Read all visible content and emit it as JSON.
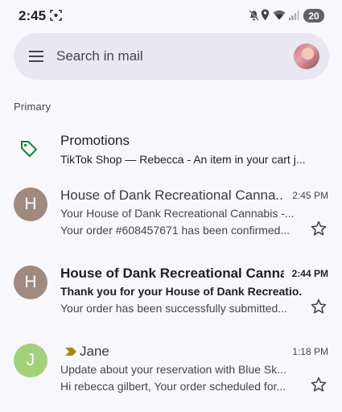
{
  "status_bar": {
    "time": "2:45",
    "battery": "20"
  },
  "search": {
    "placeholder": "Search in mail"
  },
  "section_label": "Primary",
  "promotions": {
    "title": "Promotions",
    "snippet": "TikTok Shop — Rebecca - An item in your cart j..."
  },
  "emails": [
    {
      "avatar_letter": "H",
      "avatar_color": "#a08a80",
      "sender": "House of Dank Recreational Canna...",
      "time": "2:45 PM",
      "subject": "Your House of Dank Recreational Cannabis -...",
      "snippet": "Your order #608457671 has been confirmed...",
      "unread": false
    },
    {
      "avatar_letter": "H",
      "avatar_color": "#a08a80",
      "sender": "House of Dank Recreational Canna...",
      "time": "2:44 PM",
      "subject": "Thank you for your House of Dank Recreatio...",
      "snippet": "Your order has been successfully submitted...",
      "unread": true
    },
    {
      "avatar_letter": "J",
      "avatar_color": "#a3d07a",
      "sender": "Jane",
      "time": "1:18 PM",
      "subject": "Update about your reservation with Blue Sk...",
      "snippet": "Hi rebecca gilbert, Your order scheduled for...",
      "unread": false
    }
  ],
  "colors": {
    "background": "#f8f7fc",
    "search_bg": "#e9e7ef",
    "promo_tag": "#188038",
    "important_marker": "#a5890f"
  }
}
